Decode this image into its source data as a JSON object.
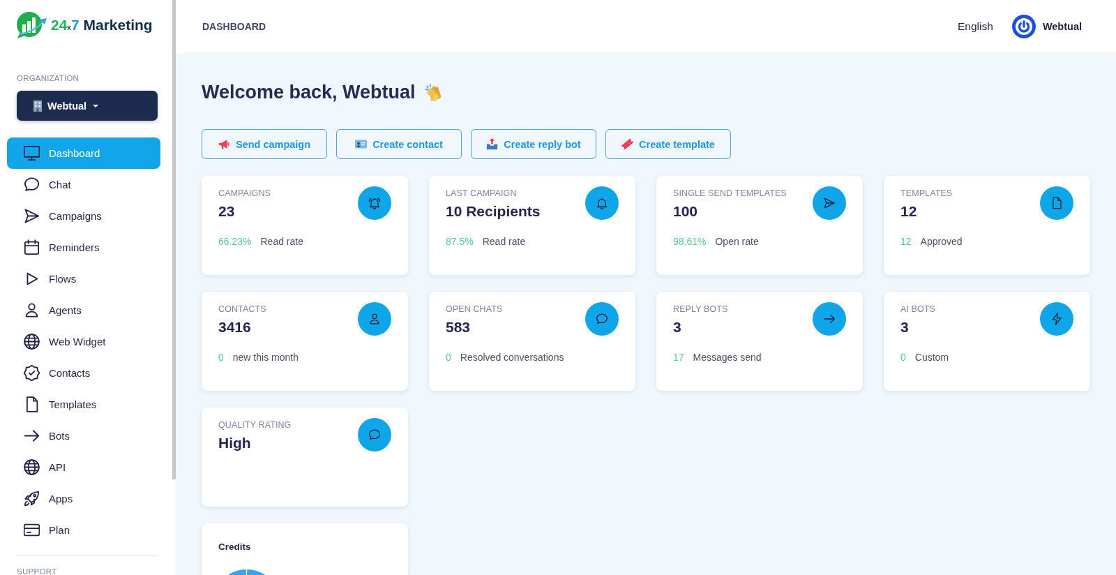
{
  "sidebar": {
    "logo": {
      "number": "24",
      "times": "x",
      "number_2": "7",
      "name": "Marketing"
    },
    "org_label": "ORGANIZATION",
    "org_name": "Webtual",
    "items": [
      {
        "label": "Dashboard",
        "kind": "dashboard",
        "selected": true
      },
      {
        "label": "Chat",
        "kind": "chat",
        "selected": false
      },
      {
        "label": "Campaigns",
        "kind": "campaigns",
        "selected": false
      },
      {
        "label": "Reminders",
        "kind": "reminders",
        "selected": false
      },
      {
        "label": "Flows",
        "kind": "flows",
        "selected": false
      },
      {
        "label": "Agents",
        "kind": "agents",
        "selected": false
      },
      {
        "label": "Web Widget",
        "kind": "widget",
        "selected": false
      },
      {
        "label": "Contacts",
        "kind": "contacts",
        "selected": false
      },
      {
        "label": "Templates",
        "kind": "templates",
        "selected": false
      },
      {
        "label": "Bots",
        "kind": "bots",
        "selected": false
      },
      {
        "label": "API",
        "kind": "api",
        "selected": false
      },
      {
        "label": "Apps",
        "kind": "apps",
        "selected": false
      },
      {
        "label": "Plan",
        "kind": "plan",
        "selected": false
      }
    ],
    "section_label": "SUPPORT"
  },
  "header": {
    "title": "DASHBOARD",
    "language": "English",
    "user": "Webtual"
  },
  "welcome": {
    "title": "Welcome back, Webtual"
  },
  "actions": [
    {
      "label": "Send campaign",
      "kind": "campaign"
    },
    {
      "label": "Create contact",
      "kind": "contact"
    },
    {
      "label": "Create reply bot",
      "kind": "bot"
    },
    {
      "label": "Create template",
      "kind": "template"
    }
  ],
  "cards": [
    {
      "kind": "campaign",
      "label": "CAMPAIGNS",
      "value": "23",
      "stat": {
        "value": "66.23%",
        "label": "Read rate"
      }
    },
    {
      "kind": "notification",
      "label": "LAST CAMPAIGN",
      "value": "10 Recipients",
      "stat": {
        "value": "87.5%",
        "label": "Read rate"
      }
    },
    {
      "kind": "send",
      "label": "SINGLE SEND TEMPLATES",
      "value": "100",
      "stat": {
        "value": "98.61%",
        "label": "Open rate"
      }
    },
    {
      "kind": "template",
      "label": "TEMPLATES",
      "value": "12",
      "stat": {
        "value": "12",
        "label": "Approved"
      }
    },
    {
      "kind": "contact",
      "label": "CONTACTS",
      "value": "3416",
      "stat": {
        "value": "0",
        "label": "new this month"
      }
    },
    {
      "kind": "chat",
      "label": "OPEN CHATS",
      "value": "583",
      "stat": {
        "value": "0",
        "label": "Resolved conversations"
      }
    },
    {
      "kind": "reply",
      "label": "REPLY BOTS",
      "value": "3",
      "stat": {
        "value": "17",
        "label": "Messages send"
      }
    },
    {
      "kind": "ai",
      "label": "AI BOTS",
      "value": "3",
      "stat": {
        "value": "0",
        "label": "Custom"
      }
    },
    {
      "kind": "quality",
      "label": "QUALITY RATING",
      "value": "High"
    }
  ],
  "credits": {
    "title": "Credits"
  }
}
